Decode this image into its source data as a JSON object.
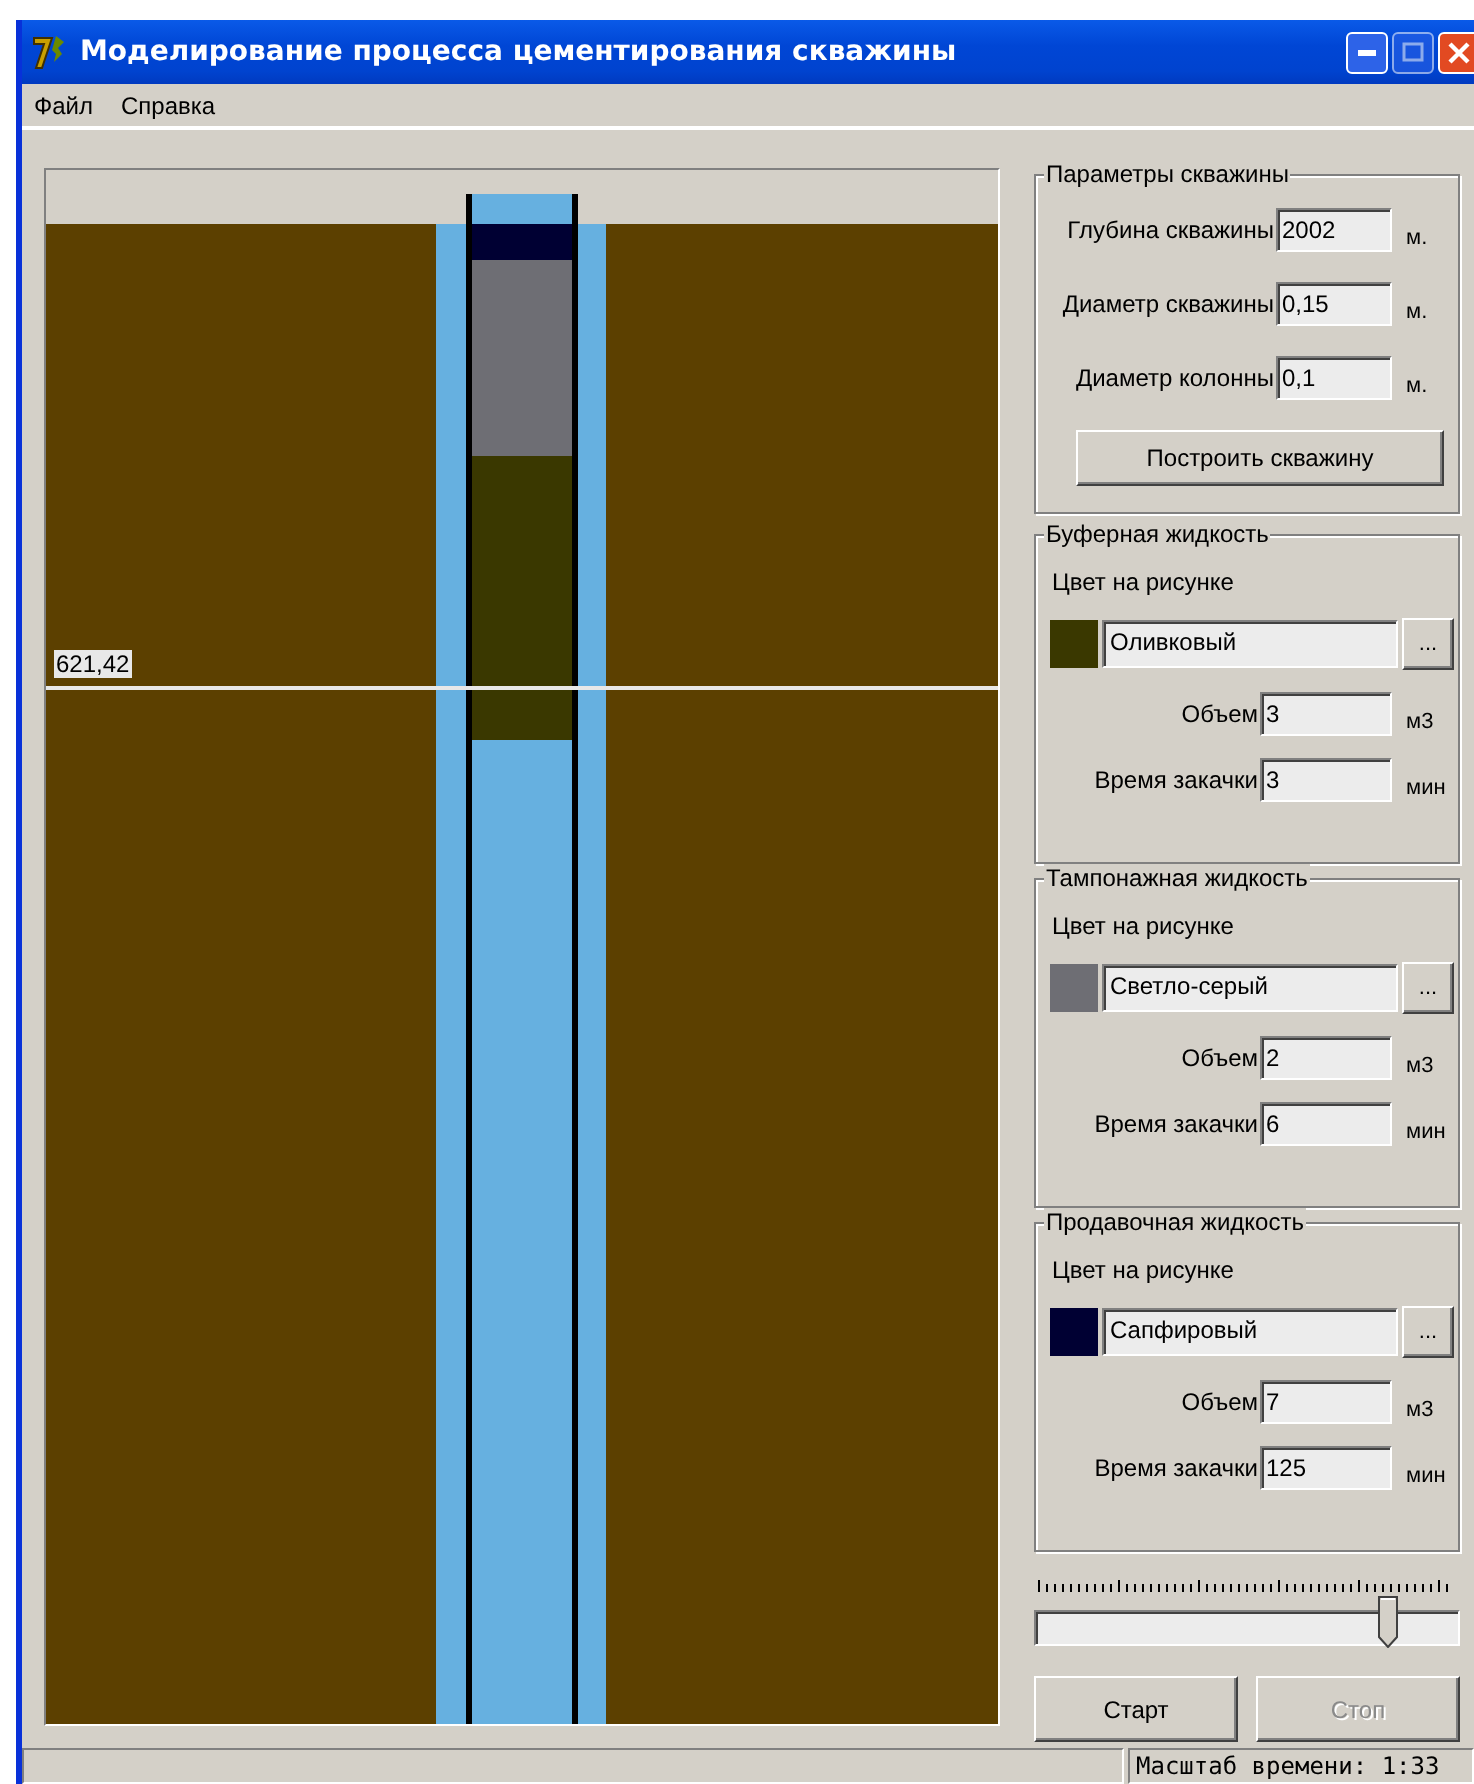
{
  "window": {
    "title": "Моделирование процесса цементирования скважины"
  },
  "menu": [
    {
      "label": "Файл"
    },
    {
      "label": "Справка"
    }
  ],
  "well_view": {
    "depth_label": "621,42"
  },
  "well_parameters": {
    "title": "Параметры скважины",
    "fields": [
      {
        "label": "Глубина скважины",
        "value": "2002",
        "unit": "м."
      },
      {
        "label": "Диаметр скважины",
        "value": "0,15",
        "unit": "м."
      },
      {
        "label": "Диаметр колонны",
        "value": "0,1",
        "unit": "м."
      }
    ],
    "button": "Построить скважину"
  },
  "fluids": [
    {
      "title": "Буферная жидкость",
      "color_label": "Цвет на рисунке",
      "color": "#3a3800",
      "color_name": "Оливковый",
      "browse_button": "...",
      "fields": [
        {
          "label": "Объем",
          "value": "3",
          "unit": "м3"
        },
        {
          "label": "Время закачки",
          "value": "3",
          "unit": "мин"
        }
      ]
    },
    {
      "title": "Тампонажная жидкость",
      "color_label": "Цвет на рисунке",
      "color": "#6e6e74",
      "color_name": "Светло-серый",
      "browse_button": "...",
      "fields": [
        {
          "label": "Объем",
          "value": "2",
          "unit": "м3"
        },
        {
          "label": "Время закачки",
          "value": "6",
          "unit": "мин"
        }
      ]
    },
    {
      "title": "Продавочная жидкость",
      "color_label": "Цвет на рисунке",
      "color": "#000033",
      "color_name": "Сапфировый",
      "browse_button": "...",
      "fields": [
        {
          "label": "Объем",
          "value": "7",
          "unit": "м3"
        },
        {
          "label": "Время закачки",
          "value": "125",
          "unit": "мин"
        }
      ]
    }
  ],
  "time_slider": {
    "level": 0.83
  },
  "buttons": [
    {
      "label": "Старт",
      "disabled": false
    },
    {
      "label": "Стоп",
      "disabled": true
    }
  ],
  "status_bar": {
    "time_scale": "Масштаб времени: 1:33"
  }
}
